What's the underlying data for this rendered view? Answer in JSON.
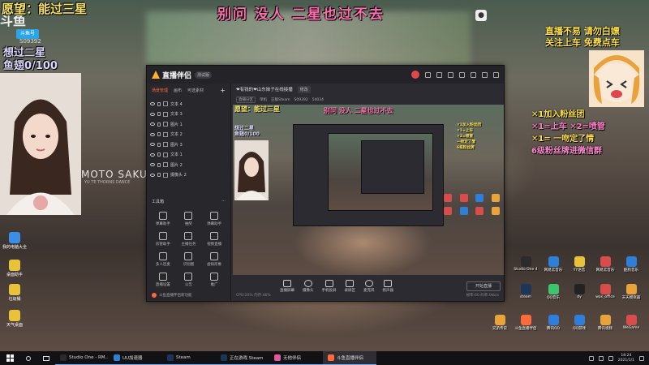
{
  "overlay": {
    "wish": "愿望：能过三星",
    "title": "别问 没人 二星也过不去",
    "pass_two": "想过二星",
    "fish_fin": "鱼翅0/100",
    "chip": "斗鱼号",
    "room_no": "S09392",
    "right_line1": "直播不易 请勿白嫖",
    "right_line2": "关注上车 免费点车",
    "rules": [
      "✕1加入粉丝团",
      "✕1=上车",
      "✕2=喷管",
      "✕1=",
      "一吻定了情",
      "6级粉丝牌进微信群"
    ],
    "watermark": "MOTO SAKURA",
    "watermark_sub": "YU TE THORNS DANCE",
    "cat_label": "●"
  },
  "app": {
    "name": "直播伴侣",
    "badge": "测试版",
    "left_tabs": [
      "场景管理",
      "画布",
      "可选素材"
    ],
    "add_label": "+",
    "sources": [
      "文本 4",
      "文本 3",
      "图片 1",
      "文本 2",
      "图片 3",
      "文本 1",
      "图片 2",
      "摄像头 2"
    ],
    "tools_title": "工具箱",
    "tools_more": "···",
    "tools": [
      "弹幕助手",
      "抽奖",
      "弹幕助手",
      "房管助手",
      "主播任务",
      "视频直播",
      "多人连麦",
      "识别图",
      "虚拟形象",
      "直播设置",
      "公告",
      "推广"
    ],
    "tool_note": "斗鱼直播伴侣新功能",
    "room_title": "❤有钱的❤山东妹子在线接播",
    "room_pill": "修改",
    "info": [
      "直播分区",
      "单机",
      "正版Steam",
      "S09392",
      "54034"
    ],
    "preview": {
      "wish": "愿望：能过三星",
      "title": "别问 没人 二星也过不去",
      "pass_two": "想过二星",
      "fish_fin": "鱼翅0/100",
      "rules": [
        "✕1加入粉丝团",
        "✕1=上车",
        "✕2=喷管",
        "一吻定了情",
        "6级粉丝牌"
      ]
    },
    "controls": [
      "直播屏幕",
      "摄像头",
      "手机投屏",
      "录屏区",
      "麦克风",
      "扬声器"
    ],
    "start_label": "开始直播",
    "status_left": "CPU:20% 内存:46%",
    "status_right": "帧率:60 码率:0kb/s"
  },
  "left_icons": [
    "我的电脑大全",
    "桌面助手",
    "垃圾桶",
    "天气桌面"
  ],
  "right_icons": [
    "Studio One 4",
    "网易云音乐",
    "YY语音",
    "网易云音乐",
    "酷狗音乐",
    "steam",
    "QQ音乐",
    "dy",
    "wps_office",
    "天天模拟器",
    "兄弟传说",
    "斗鱼直播伴侣",
    "腾讯QQ",
    "QQ游戏",
    "腾讯视频",
    "WeGame"
  ],
  "taskbar": {
    "tasks": [
      "Studio One - RM..",
      "UU加速器",
      "Steam",
      "正在游戏 Steam",
      "无他伴侣",
      "斗鱼直播伴侣"
    ],
    "time": "18:24",
    "date": "2021/1/1"
  },
  "colors": {
    "accent": "#ff6a3d",
    "title_pink": "#ff6fb0",
    "wish_yellow": "#f5e06a"
  }
}
